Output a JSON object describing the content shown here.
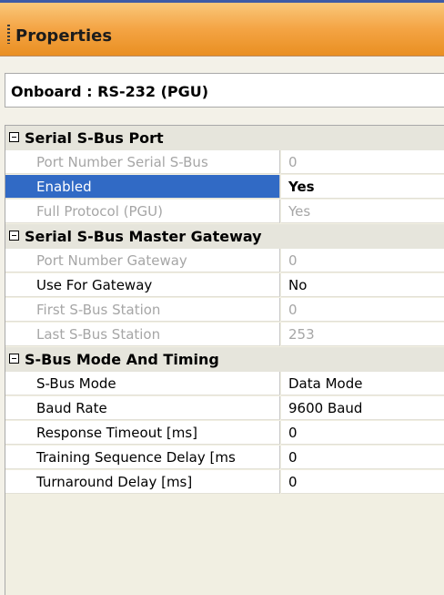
{
  "panel": {
    "title": "Properties"
  },
  "object_selector": {
    "value": "Onboard : RS-232 (PGU)"
  },
  "categories": [
    {
      "label": "Serial S-Bus Port",
      "rows": [
        {
          "name": "Port Number Serial S-Bus",
          "value": "0"
        },
        {
          "name": "Enabled",
          "value": "Yes"
        },
        {
          "name": "Full Protocol (PGU)",
          "value": "Yes"
        }
      ]
    },
    {
      "label": "Serial S-Bus Master Gateway",
      "rows": [
        {
          "name": "Port Number Gateway",
          "value": "0"
        },
        {
          "name": "Use For Gateway",
          "value": "No"
        },
        {
          "name": "First S-Bus Station",
          "value": "0"
        },
        {
          "name": "Last S-Bus Station",
          "value": "253"
        }
      ]
    },
    {
      "label": "S-Bus Mode And Timing",
      "rows": [
        {
          "name": "S-Bus Mode",
          "value": "Data Mode"
        },
        {
          "name": "Baud Rate",
          "value": "9600 Baud"
        },
        {
          "name": "Response Timeout [ms]",
          "value": "0"
        },
        {
          "name": "Training Sequence Delay [ms",
          "value": "0"
        },
        {
          "name": "Turnaround Delay [ms]",
          "value": "0"
        }
      ]
    }
  ],
  "colors": {
    "title_bar": "#f4a444",
    "selection": "#316ac5",
    "readonly_text": "#a6a6a6"
  }
}
